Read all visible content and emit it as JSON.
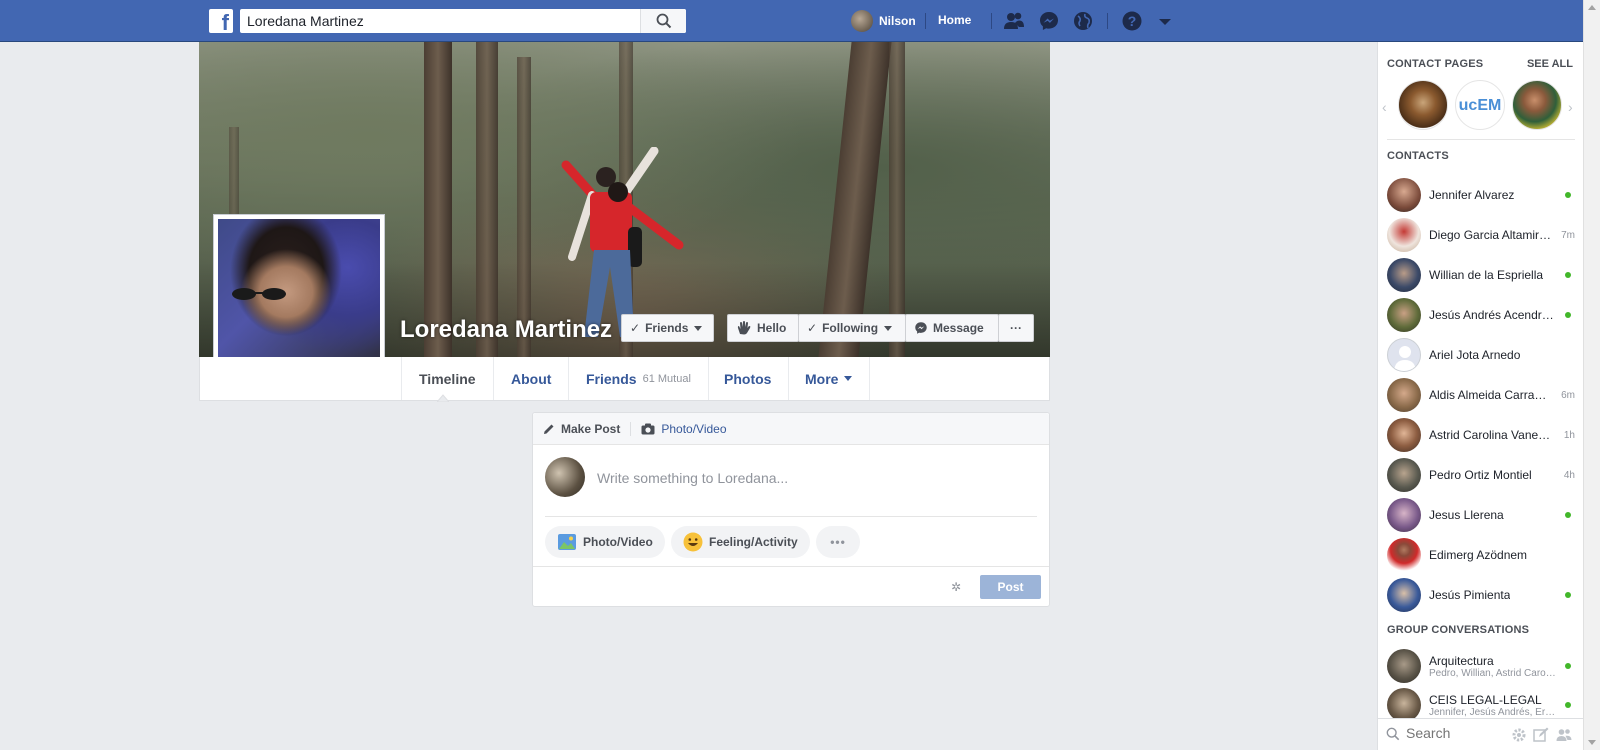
{
  "topbar": {
    "logo": "f",
    "search_value": "Loredana Martinez",
    "user_name": "Nilson",
    "home_label": "Home"
  },
  "profile": {
    "name": "Loredana Martinez",
    "buttons": {
      "friends": "Friends",
      "hello": "Hello",
      "following": "Following",
      "message": "Message",
      "more": "···"
    }
  },
  "tabs": [
    {
      "label": "Timeline"
    },
    {
      "label": "About"
    },
    {
      "label": "Friends",
      "sub": "61 Mutual"
    },
    {
      "label": "Photos"
    },
    {
      "label": "More"
    }
  ],
  "composer": {
    "make_post": "Make Post",
    "photo_video_tab": "Photo/Video",
    "placeholder": "Write something to Loredana...",
    "photo_video": "Photo/Video",
    "feeling": "Feeling/Activity",
    "more": "•••",
    "post": "Post"
  },
  "sidebar": {
    "contact_pages": "CONTACT PAGES",
    "see_all": "SEE ALL",
    "contacts_head": "CONTACTS",
    "groups_head": "GROUP CONVERSATIONS",
    "search_placeholder": "Search",
    "contacts": [
      {
        "name": "Jennifer Alvarez",
        "status": "online"
      },
      {
        "name": "Diego Garcia Altamir…",
        "status": "7m"
      },
      {
        "name": "Willian de la Espriella",
        "status": "online"
      },
      {
        "name": "Jesús Andrés Acendr…",
        "status": "online"
      },
      {
        "name": "Ariel Jota Arnedo",
        "status": ""
      },
      {
        "name": "Aldis Almeida Carra…",
        "status": "6m"
      },
      {
        "name": "Astrid Carolina Vane…",
        "status": "1h"
      },
      {
        "name": "Pedro Ortiz Montiel",
        "status": "4h"
      },
      {
        "name": "Jesus Llerena",
        "status": "online"
      },
      {
        "name": "Edimerg Azödnem",
        "status": ""
      },
      {
        "name": "Jesús Pimienta",
        "status": "online"
      }
    ],
    "groups": [
      {
        "name": "Arquitectura",
        "members": "Pedro, Willian, Astrid Caro…",
        "status": "online"
      },
      {
        "name": "CEIS LEGAL-LEGAL",
        "members": "Jennifer, Jesús Andrés, Er…",
        "status": "online"
      }
    ]
  },
  "colors": {
    "brand": "#4267b2",
    "link": "#365899",
    "online": "#42b72a",
    "post_button": "#9cb4d8"
  }
}
